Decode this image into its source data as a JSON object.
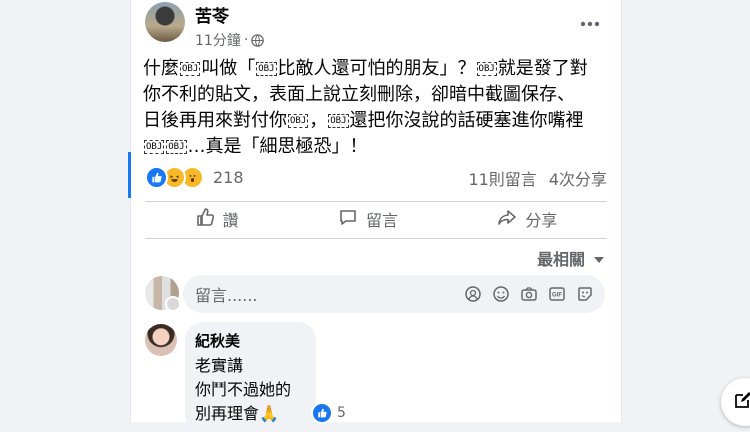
{
  "post": {
    "author": "苦苓",
    "time": "11分鐘",
    "separator": "·",
    "obj_marker": "OBJ",
    "lines": [
      [
        "什麼",
        "OBJ",
        "叫做「",
        "OBJ",
        "比敵人還可怕的朋友」？",
        "OBJ",
        "就是發了對"
      ],
      [
        "你不利的貼文，表面上說立刻刪除，卻暗中截圖保存、"
      ],
      [
        "日後再用來對付你",
        "OBJ",
        "，",
        "OBJ",
        "還把你沒說的話硬塞進你嘴裡"
      ],
      [
        "OBJ",
        "OBJ",
        "…真是「細思極恐」！"
      ]
    ]
  },
  "stats": {
    "reaction_count": "218",
    "comments": "11則留言",
    "shares": "4次分享"
  },
  "actions": {
    "like": "讚",
    "comment": "留言",
    "share": "分享"
  },
  "sort": {
    "label": "最相關"
  },
  "composer": {
    "placeholder": "留言......"
  },
  "comment": {
    "name": "紀秋美",
    "lines": [
      "老實講",
      "你鬥不過她的",
      "別再理會🙏"
    ],
    "likes": "5"
  },
  "icons": {
    "like": "thumbs-up-icon",
    "comment": "speech-bubble-icon",
    "share": "share-arrow-icon",
    "globe": "globe-icon",
    "more": "more-dots-icon",
    "sort": "caret-down-icon",
    "edit": "edit-compose-icon"
  },
  "colors": {
    "accent": "#1877f2",
    "secondary_text": "#65676b",
    "bubble": "#f0f2f5"
  }
}
